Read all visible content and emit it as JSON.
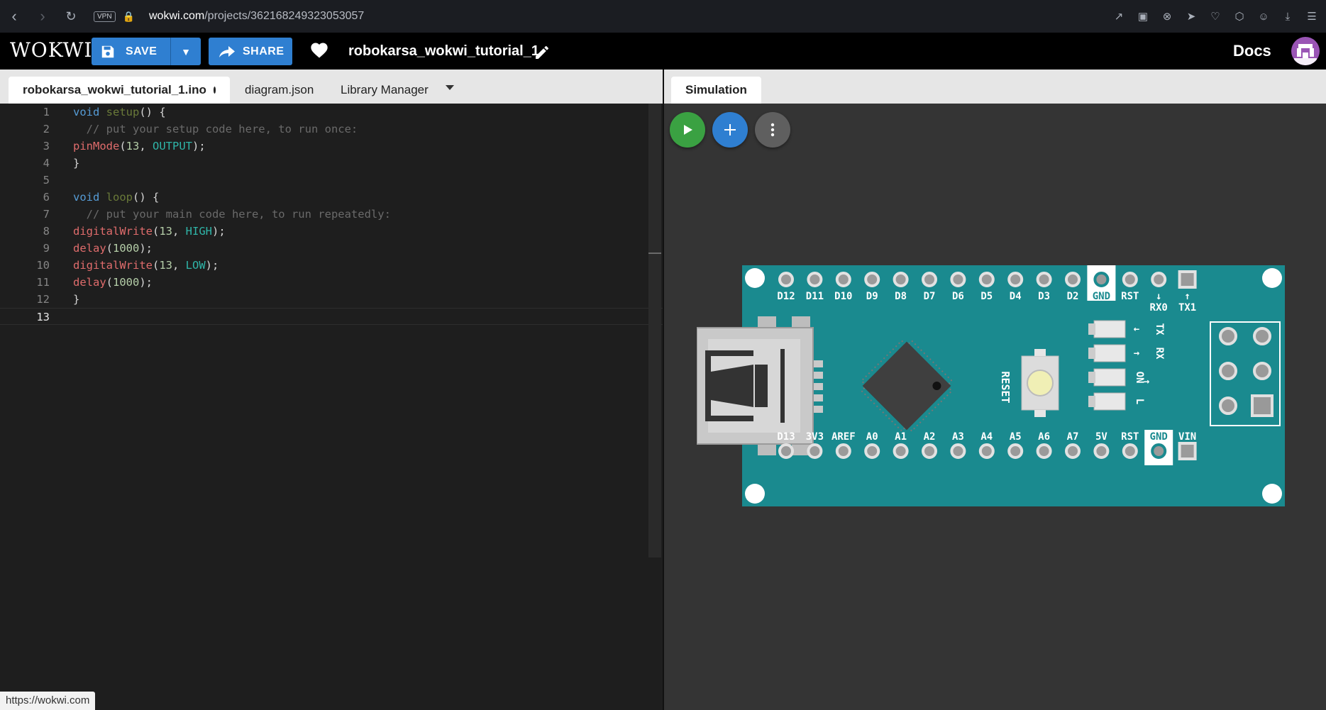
{
  "browser": {
    "vpn_label": "VPN",
    "url_host": "wokwi.com",
    "url_path": "/projects/362168249323053057"
  },
  "header": {
    "logo": "WOKWI",
    "save_label": "SAVE",
    "share_label": "SHARE",
    "project_name": "robokarsa_wokwi_tutorial_1",
    "docs_label": "Docs"
  },
  "editor": {
    "tabs": [
      {
        "label": "robokarsa_wokwi_tutorial_1.ino"
      },
      {
        "label": "diagram.json"
      },
      {
        "label": "Library Manager"
      }
    ],
    "lines": [
      {
        "n": "1",
        "text": "void setup() {"
      },
      {
        "n": "2",
        "text": "  // put your setup code here, to run once:"
      },
      {
        "n": "3",
        "text": "pinMode(13, OUTPUT);"
      },
      {
        "n": "4",
        "text": "}"
      },
      {
        "n": "5",
        "text": ""
      },
      {
        "n": "6",
        "text": "void loop() {"
      },
      {
        "n": "7",
        "text": "  // put your main code here, to run repeatedly:"
      },
      {
        "n": "8",
        "text": "digitalWrite(13, HIGH);"
      },
      {
        "n": "9",
        "text": "delay(1000);"
      },
      {
        "n": "10",
        "text": "digitalWrite(13, LOW);"
      },
      {
        "n": "11",
        "text": "delay(1000);"
      },
      {
        "n": "12",
        "text": "}"
      },
      {
        "n": "13",
        "text": ""
      }
    ]
  },
  "simulation": {
    "tab_label": "Simulation",
    "board": {
      "top_pins": [
        "D12",
        "D11",
        "D10",
        "D9",
        "D8",
        "D7",
        "D6",
        "D5",
        "D4",
        "D3",
        "D2",
        "GND",
        "RST",
        "RX0",
        "TX1"
      ],
      "bottom_pins": [
        "D13",
        "3V3",
        "AREF",
        "A0",
        "A1",
        "A2",
        "A3",
        "A4",
        "A5",
        "A6",
        "A7",
        "5V",
        "RST",
        "GND",
        "VIN"
      ],
      "led_labels": [
        "TX",
        "RX",
        "ON",
        "L"
      ],
      "reset_label": "RESET",
      "color": "#1a8a8f"
    }
  },
  "status_bar": {
    "url": "https://wokwi.com"
  },
  "colors": {
    "accent": "#2f7fd1",
    "play": "#3aa142"
  }
}
